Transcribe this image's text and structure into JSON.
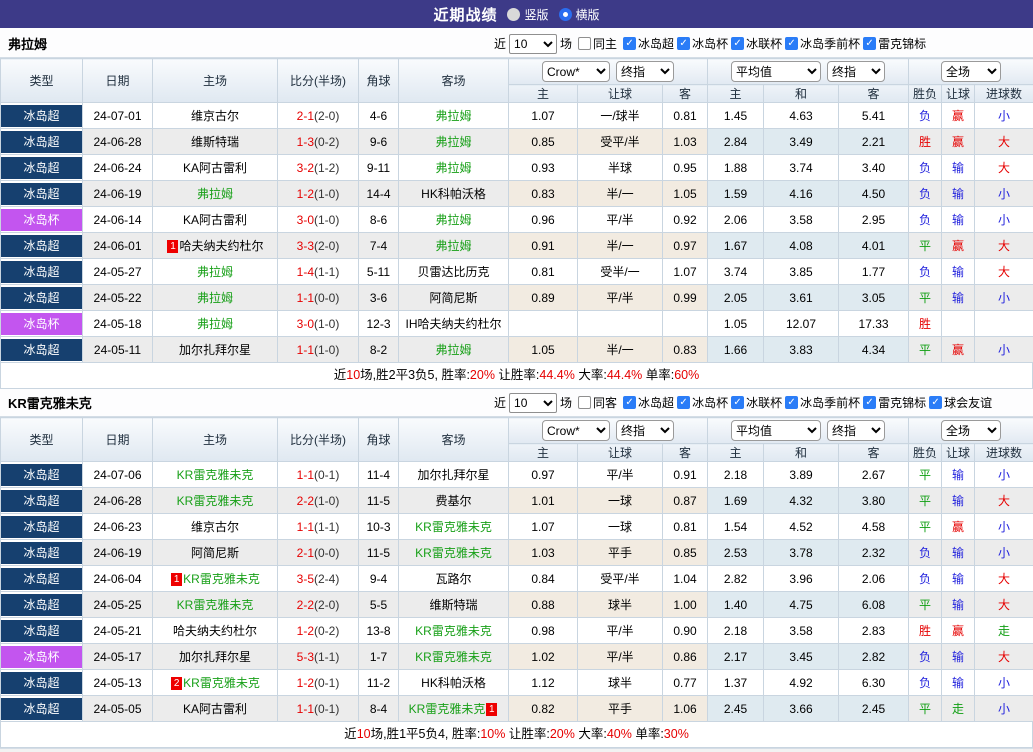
{
  "titlebar": {
    "title": "近期战绩",
    "radios": [
      {
        "label": "竖版",
        "selected": false
      },
      {
        "label": "横版",
        "selected": true
      }
    ]
  },
  "colors": {
    "titlebar_bg": "#3d3a88",
    "league_super_bg": "#16406f",
    "league_cup_bg": "#c355ef",
    "checkbox_blue": "#2a7cf7",
    "win_red": "#e60000",
    "lose_blue": "#2222dd",
    "draw_green": "#0f9e12",
    "team_green": "#18a018"
  },
  "columns": {
    "type": "类型",
    "date": "日期",
    "home": "主场",
    "score": "比分(半场)",
    "corner": "角球",
    "away": "客场",
    "dd_company": "Crow*",
    "dd_final1": "终指",
    "dd_average": "平均值",
    "dd_final2": "终指",
    "dd_scope": "全场",
    "sub_home": "主",
    "sub_handicap": "让球",
    "sub_away": "客",
    "sub_avg_home": "主",
    "sub_draw": "和",
    "sub_avg_away": "客",
    "sub_result": "胜负",
    "sub_result_handicap": "让球",
    "sub_goals": "进球数"
  },
  "sections": [
    {
      "team": "弗拉姆",
      "filter": {
        "near": "近",
        "count": "10",
        "games": "场",
        "same": "同主",
        "same_checked": false,
        "leagues": [
          "冰岛超",
          "冰岛杯",
          "冰联杯",
          "冰岛季前杯",
          "雷克锦标"
        ]
      },
      "matches": [
        {
          "league": "冰岛超",
          "cup": false,
          "date": "24-07-01",
          "home": "维京古尔",
          "home_green": false,
          "home_badge": "",
          "score": "2-1",
          "half": "(2-0)",
          "corner": "4-6",
          "away": "弗拉姆",
          "away_green": true,
          "away_badge": "",
          "crow": [
            "1.07",
            "一/球半",
            "0.81"
          ],
          "avg": [
            "1.45",
            "4.63",
            "5.41"
          ],
          "res": [
            "负",
            "赢",
            "小"
          ]
        },
        {
          "league": "冰岛超",
          "cup": false,
          "date": "24-06-28",
          "home": "维斯特瑞",
          "home_green": false,
          "home_badge": "",
          "score": "1-3",
          "half": "(0-2)",
          "corner": "9-6",
          "away": "弗拉姆",
          "away_green": true,
          "away_badge": "",
          "crow": [
            "0.85",
            "受平/半",
            "1.03"
          ],
          "avg": [
            "2.84",
            "3.49",
            "2.21"
          ],
          "res": [
            "胜",
            "赢",
            "大"
          ]
        },
        {
          "league": "冰岛超",
          "cup": false,
          "date": "24-06-24",
          "home": "KA阿古雷利",
          "home_green": false,
          "home_badge": "",
          "score": "3-2",
          "half": "(1-2)",
          "corner": "9-11",
          "away": "弗拉姆",
          "away_green": true,
          "away_badge": "",
          "crow": [
            "0.93",
            "半球",
            "0.95"
          ],
          "avg": [
            "1.88",
            "3.74",
            "3.40"
          ],
          "res": [
            "负",
            "输",
            "大"
          ]
        },
        {
          "league": "冰岛超",
          "cup": false,
          "date": "24-06-19",
          "home": "弗拉姆",
          "home_green": true,
          "home_badge": "",
          "score": "1-2",
          "half": "(1-0)",
          "corner": "14-4",
          "away": "HK科帕沃格",
          "away_green": false,
          "away_badge": "",
          "crow": [
            "0.83",
            "半/一",
            "1.05"
          ],
          "avg": [
            "1.59",
            "4.16",
            "4.50"
          ],
          "res": [
            "负",
            "输",
            "小"
          ]
        },
        {
          "league": "冰岛杯",
          "cup": true,
          "date": "24-06-14",
          "home": "KA阿古雷利",
          "home_green": false,
          "home_badge": "",
          "score": "3-0",
          "half": "(1-0)",
          "corner": "8-6",
          "away": "弗拉姆",
          "away_green": true,
          "away_badge": "",
          "crow": [
            "0.96",
            "平/半",
            "0.92"
          ],
          "avg": [
            "2.06",
            "3.58",
            "2.95"
          ],
          "res": [
            "负",
            "输",
            "小"
          ]
        },
        {
          "league": "冰岛超",
          "cup": false,
          "date": "24-06-01",
          "home": "哈夫纳夫约杜尔",
          "home_green": false,
          "home_badge": "1",
          "score": "3-3",
          "half": "(2-0)",
          "corner": "7-4",
          "away": "弗拉姆",
          "away_green": true,
          "away_badge": "",
          "crow": [
            "0.91",
            "半/一",
            "0.97"
          ],
          "avg": [
            "1.67",
            "4.08",
            "4.01"
          ],
          "res": [
            "平",
            "赢",
            "大"
          ]
        },
        {
          "league": "冰岛超",
          "cup": false,
          "date": "24-05-27",
          "home": "弗拉姆",
          "home_green": true,
          "home_badge": "",
          "score": "1-4",
          "half": "(1-1)",
          "corner": "5-11",
          "away": "贝雷达比历克",
          "away_green": false,
          "away_badge": "",
          "crow": [
            "0.81",
            "受半/一",
            "1.07"
          ],
          "avg": [
            "3.74",
            "3.85",
            "1.77"
          ],
          "res": [
            "负",
            "输",
            "大"
          ]
        },
        {
          "league": "冰岛超",
          "cup": false,
          "date": "24-05-22",
          "home": "弗拉姆",
          "home_green": true,
          "home_badge": "",
          "score": "1-1",
          "half": "(0-0)",
          "corner": "3-6",
          "away": "阿简尼斯",
          "away_green": false,
          "away_badge": "",
          "crow": [
            "0.89",
            "平/半",
            "0.99"
          ],
          "avg": [
            "2.05",
            "3.61",
            "3.05"
          ],
          "res": [
            "平",
            "输",
            "小"
          ]
        },
        {
          "league": "冰岛杯",
          "cup": true,
          "date": "24-05-18",
          "home": "弗拉姆",
          "home_green": true,
          "home_badge": "",
          "score": "3-0",
          "half": "(1-0)",
          "corner": "12-3",
          "away": "IH哈夫纳夫约杜尔",
          "away_green": false,
          "away_badge": "",
          "crow": [
            "",
            "",
            ""
          ],
          "avg": [
            "1.05",
            "12.07",
            "17.33"
          ],
          "res": [
            "胜",
            "",
            ""
          ]
        },
        {
          "league": "冰岛超",
          "cup": false,
          "date": "24-05-11",
          "home": "加尔扎拜尔星",
          "home_green": false,
          "home_badge": "",
          "score": "1-1",
          "half": "(1-0)",
          "corner": "8-2",
          "away": "弗拉姆",
          "away_green": true,
          "away_badge": "",
          "crow": [
            "1.05",
            "半/一",
            "0.83"
          ],
          "avg": [
            "1.66",
            "3.83",
            "4.34"
          ],
          "res": [
            "平",
            "赢",
            "小"
          ]
        }
      ],
      "summary": [
        {
          "t": "近",
          "red": false
        },
        {
          "t": "10",
          "red": true
        },
        {
          "t": "场,胜2平3负5, 胜率:",
          "red": false
        },
        {
          "t": "20%",
          "red": true
        },
        {
          "t": " 让胜率:",
          "red": false
        },
        {
          "t": "44.4%",
          "red": true
        },
        {
          "t": " 大率:",
          "red": false
        },
        {
          "t": "44.4%",
          "red": true
        },
        {
          "t": " 单率:",
          "red": false
        },
        {
          "t": "60%",
          "red": true
        }
      ]
    },
    {
      "team": "KR雷克雅未克",
      "filter": {
        "near": "近",
        "count": "10",
        "games": "场",
        "same": "同客",
        "same_checked": false,
        "leagues": [
          "冰岛超",
          "冰岛杯",
          "冰联杯",
          "冰岛季前杯",
          "雷克锦标",
          "球会友谊"
        ]
      },
      "matches": [
        {
          "league": "冰岛超",
          "cup": false,
          "date": "24-07-06",
          "home": "KR雷克雅未克",
          "home_green": true,
          "home_badge": "",
          "score": "1-1",
          "half": "(0-1)",
          "corner": "11-4",
          "away": "加尔扎拜尔星",
          "away_green": false,
          "away_badge": "",
          "crow": [
            "0.97",
            "平/半",
            "0.91"
          ],
          "avg": [
            "2.18",
            "3.89",
            "2.67"
          ],
          "res": [
            "平",
            "输",
            "小"
          ]
        },
        {
          "league": "冰岛超",
          "cup": false,
          "date": "24-06-28",
          "home": "KR雷克雅未克",
          "home_green": true,
          "home_badge": "",
          "score": "2-2",
          "half": "(1-0)",
          "corner": "11-5",
          "away": "费基尔",
          "away_green": false,
          "away_badge": "",
          "crow": [
            "1.01",
            "一球",
            "0.87"
          ],
          "avg": [
            "1.69",
            "4.32",
            "3.80"
          ],
          "res": [
            "平",
            "输",
            "大"
          ]
        },
        {
          "league": "冰岛超",
          "cup": false,
          "date": "24-06-23",
          "home": "维京古尔",
          "home_green": false,
          "home_badge": "",
          "score": "1-1",
          "half": "(1-1)",
          "corner": "10-3",
          "away": "KR雷克雅未克",
          "away_green": true,
          "away_badge": "",
          "crow": [
            "1.07",
            "一球",
            "0.81"
          ],
          "avg": [
            "1.54",
            "4.52",
            "4.58"
          ],
          "res": [
            "平",
            "赢",
            "小"
          ]
        },
        {
          "league": "冰岛超",
          "cup": false,
          "date": "24-06-19",
          "home": "阿简尼斯",
          "home_green": false,
          "home_badge": "",
          "score": "2-1",
          "half": "(0-0)",
          "corner": "11-5",
          "away": "KR雷克雅未克",
          "away_green": true,
          "away_badge": "",
          "crow": [
            "1.03",
            "平手",
            "0.85"
          ],
          "avg": [
            "2.53",
            "3.78",
            "2.32"
          ],
          "res": [
            "负",
            "输",
            "小"
          ]
        },
        {
          "league": "冰岛超",
          "cup": false,
          "date": "24-06-04",
          "home": "KR雷克雅未克",
          "home_green": true,
          "home_badge": "1",
          "score": "3-5",
          "half": "(2-4)",
          "corner": "9-4",
          "away": "瓦路尔",
          "away_green": false,
          "away_badge": "",
          "crow": [
            "0.84",
            "受平/半",
            "1.04"
          ],
          "avg": [
            "2.82",
            "3.96",
            "2.06"
          ],
          "res": [
            "负",
            "输",
            "大"
          ]
        },
        {
          "league": "冰岛超",
          "cup": false,
          "date": "24-05-25",
          "home": "KR雷克雅未克",
          "home_green": true,
          "home_badge": "",
          "score": "2-2",
          "half": "(2-0)",
          "corner": "5-5",
          "away": "维斯特瑞",
          "away_green": false,
          "away_badge": "",
          "crow": [
            "0.88",
            "球半",
            "1.00"
          ],
          "avg": [
            "1.40",
            "4.75",
            "6.08"
          ],
          "res": [
            "平",
            "输",
            "大"
          ]
        },
        {
          "league": "冰岛超",
          "cup": false,
          "date": "24-05-21",
          "home": "哈夫纳夫约杜尔",
          "home_green": false,
          "home_badge": "",
          "score": "1-2",
          "half": "(0-2)",
          "corner": "13-8",
          "away": "KR雷克雅未克",
          "away_green": true,
          "away_badge": "",
          "crow": [
            "0.98",
            "平/半",
            "0.90"
          ],
          "avg": [
            "2.18",
            "3.58",
            "2.83"
          ],
          "res": [
            "胜",
            "赢",
            "走"
          ]
        },
        {
          "league": "冰岛杯",
          "cup": true,
          "date": "24-05-17",
          "home": "加尔扎拜尔星",
          "home_green": false,
          "home_badge": "",
          "score": "5-3",
          "half": "(1-1)",
          "corner": "1-7",
          "away": "KR雷克雅未克",
          "away_green": true,
          "away_badge": "",
          "crow": [
            "1.02",
            "平/半",
            "0.86"
          ],
          "avg": [
            "2.17",
            "3.45",
            "2.82"
          ],
          "res": [
            "负",
            "输",
            "大"
          ]
        },
        {
          "league": "冰岛超",
          "cup": false,
          "date": "24-05-13",
          "home": "KR雷克雅未克",
          "home_green": true,
          "home_badge": "2",
          "score": "1-2",
          "half": "(0-1)",
          "corner": "11-2",
          "away": "HK科帕沃格",
          "away_green": false,
          "away_badge": "",
          "crow": [
            "1.12",
            "球半",
            "0.77"
          ],
          "avg": [
            "1.37",
            "4.92",
            "6.30"
          ],
          "res": [
            "负",
            "输",
            "小"
          ]
        },
        {
          "league": "冰岛超",
          "cup": false,
          "date": "24-05-05",
          "home": "KA阿古雷利",
          "home_green": false,
          "home_badge": "",
          "score": "1-1",
          "half": "(0-1)",
          "corner": "8-4",
          "away": "KR雷克雅未克",
          "away_green": true,
          "away_badge": "1",
          "crow": [
            "0.82",
            "平手",
            "1.06"
          ],
          "avg": [
            "2.45",
            "3.66",
            "2.45"
          ],
          "res": [
            "平",
            "走",
            "小"
          ]
        }
      ],
      "summary": [
        {
          "t": "近",
          "red": false
        },
        {
          "t": "10",
          "red": true
        },
        {
          "t": "场,胜1平5负4, 胜率:",
          "red": false
        },
        {
          "t": "10%",
          "red": true
        },
        {
          "t": " 让胜率:",
          "red": false
        },
        {
          "t": "20%",
          "red": true
        },
        {
          "t": " 大率:",
          "red": false
        },
        {
          "t": "40%",
          "red": true
        },
        {
          "t": " 单率:",
          "red": false
        },
        {
          "t": "30%",
          "red": true
        }
      ]
    }
  ]
}
